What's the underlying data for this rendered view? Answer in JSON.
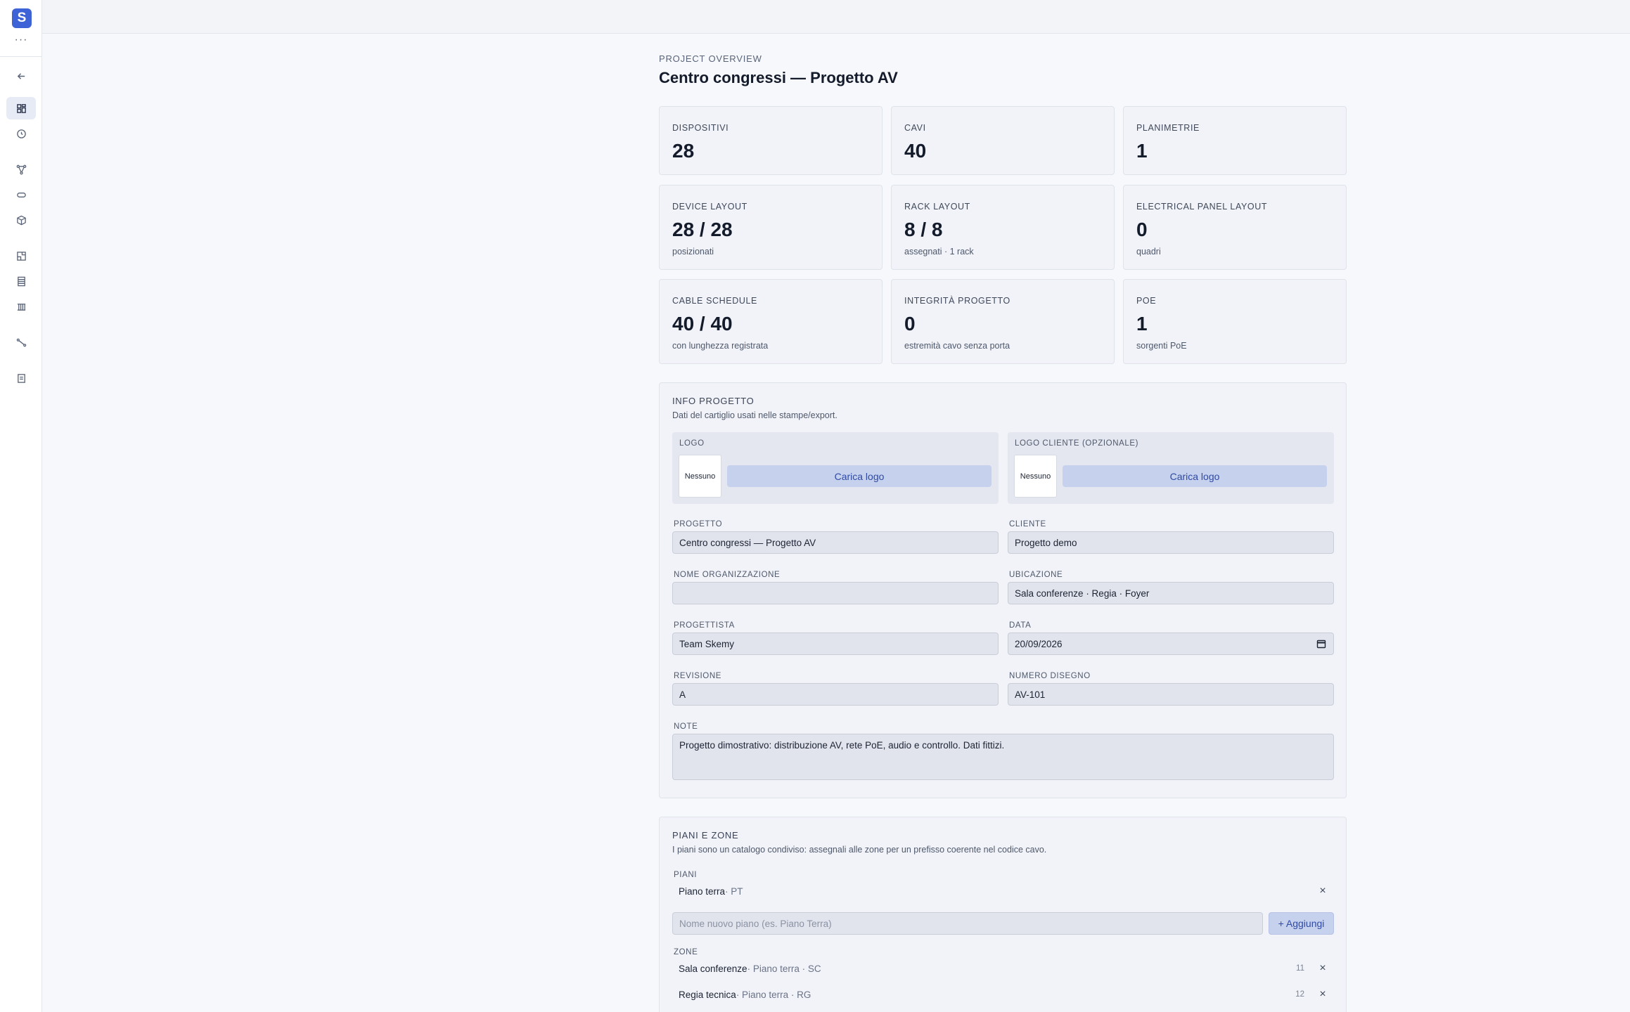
{
  "sidebar": {
    "logo_letter": "S",
    "more": "···",
    "items": [
      {
        "icon": "back-arrow-icon"
      },
      {
        "icon": "dashboard-icon",
        "active": true
      },
      {
        "icon": "clock-icon"
      },
      {
        "icon": "network-icon"
      },
      {
        "icon": "cable-icon"
      },
      {
        "icon": "box-icon"
      },
      {
        "icon": "floorplan-icon"
      },
      {
        "icon": "rack-icon"
      },
      {
        "icon": "panel-icon"
      },
      {
        "icon": "link-icon"
      },
      {
        "icon": "document-icon"
      }
    ]
  },
  "header": {
    "eyebrow": "PROJECT OVERVIEW",
    "title": "Centro congressi — Progetto AV"
  },
  "stats": [
    {
      "label": "DISPOSITIVI",
      "value": "28",
      "sub": ""
    },
    {
      "label": "CAVI",
      "value": "40",
      "sub": ""
    },
    {
      "label": "PLANIMETRIE",
      "value": "1",
      "sub": ""
    },
    {
      "label": "DEVICE LAYOUT",
      "value": "28 / 28",
      "sub": "posizionati"
    },
    {
      "label": "RACK LAYOUT",
      "value": "8 / 8",
      "sub": "assegnati · 1 rack"
    },
    {
      "label": "ELECTRICAL PANEL LAYOUT",
      "value": "0",
      "sub": "quadri"
    },
    {
      "label": "CABLE SCHEDULE",
      "value": "40 / 40",
      "sub": "con lunghezza registrata"
    },
    {
      "label": "INTEGRITÀ PROGETTO",
      "value": "0",
      "sub": "estremità cavo senza porta"
    },
    {
      "label": "POE",
      "value": "1",
      "sub": "sorgenti PoE"
    }
  ],
  "info": {
    "title": "INFO PROGETTO",
    "description": "Dati del cartiglio usati nelle stampe/export.",
    "logo": {
      "label": "LOGO",
      "thumb": "Nessuno",
      "button": "Carica logo"
    },
    "client_logo": {
      "label": "LOGO CLIENTE (OPZIONALE)",
      "thumb": "Nessuno",
      "button": "Carica logo"
    },
    "fields": {
      "progetto": {
        "label": "PROGETTO",
        "value": "Centro congressi — Progetto AV"
      },
      "cliente": {
        "label": "CLIENTE",
        "value": "Progetto demo"
      },
      "organizzazione": {
        "label": "NOME ORGANIZZAZIONE",
        "value": ""
      },
      "ubicazione": {
        "label": "UBICAZIONE",
        "value": "Sala conferenze · Regia · Foyer"
      },
      "progettista": {
        "label": "PROGETTISTA",
        "value": "Team Skemy"
      },
      "data": {
        "label": "DATA",
        "value": "20/09/2026"
      },
      "revisione": {
        "label": "REVISIONE",
        "value": "A"
      },
      "numero_disegno": {
        "label": "NUMERO DISEGNO",
        "value": "AV-101"
      },
      "note": {
        "label": "NOTE",
        "value": "Progetto dimostrativo: distribuzione AV, rete PoE, audio e controllo. Dati fittizi."
      }
    }
  },
  "floors": {
    "title": "PIANI E ZONE",
    "description": "I piani sono un catalogo condiviso: assegnali alle zone per un prefisso coerente nel codice cavo.",
    "piani_label": "PIANI",
    "piani": [
      {
        "name": "Piano terra",
        "meta": " · PT"
      }
    ],
    "new_floor_placeholder": "Nome nuovo piano (es. Piano Terra)",
    "add_button": "+ Aggiungi",
    "zone_label": "ZONE",
    "zone": [
      {
        "name": "Sala conferenze",
        "meta": " · Piano terra · SC",
        "count": "11"
      },
      {
        "name": "Regia tecnica",
        "meta": " · Piano terra · RG",
        "count": "12"
      }
    ]
  },
  "colors": {
    "accent": "#3d63d6",
    "button_bg": "#c6d1ee",
    "button_text": "#2f4aa3"
  }
}
